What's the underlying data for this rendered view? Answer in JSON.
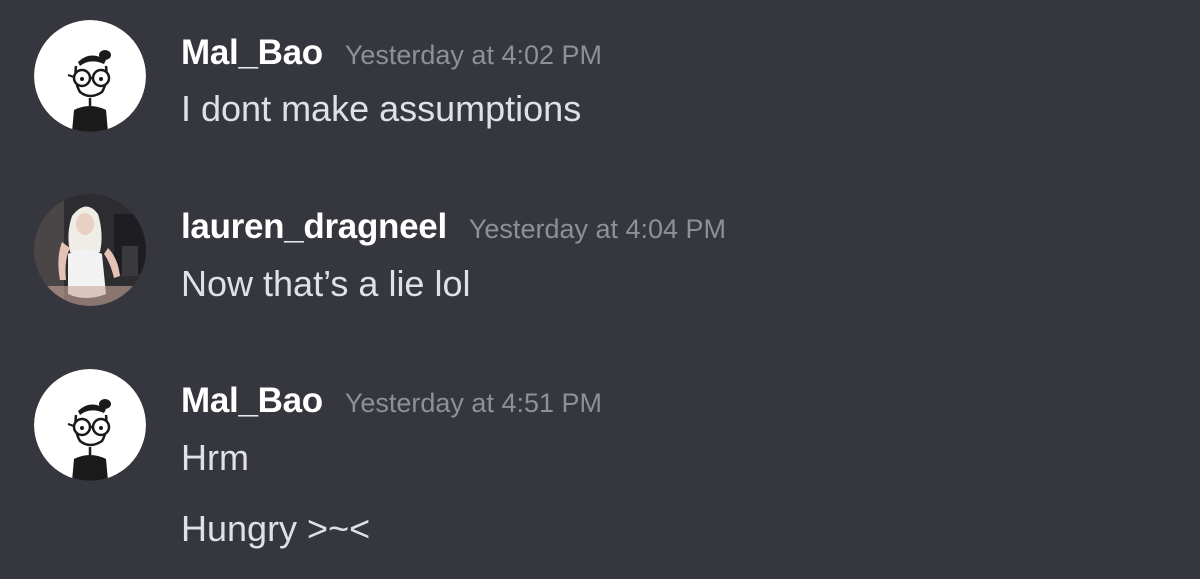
{
  "messages": [
    {
      "username": "Mal_Bao",
      "timestamp": "Yesterday at 4:02 PM",
      "lines": [
        "I dont make assumptions"
      ],
      "avatar": "cartoon-glasses-avatar-icon"
    },
    {
      "username": "lauren_dragneel",
      "timestamp": "Yesterday at 4:04 PM",
      "lines": [
        "Now that’s a lie lol"
      ],
      "avatar": "photo-avatar"
    },
    {
      "username": "Mal_Bao",
      "timestamp": "Yesterday at 4:51 PM",
      "lines": [
        "Hrm",
        "Hungry >~<"
      ],
      "avatar": "cartoon-glasses-avatar-icon"
    }
  ],
  "colors": {
    "background": "#36373e",
    "username": "#ffffff",
    "timestamp": "#8e9096",
    "message_text": "#dfe1e5"
  }
}
